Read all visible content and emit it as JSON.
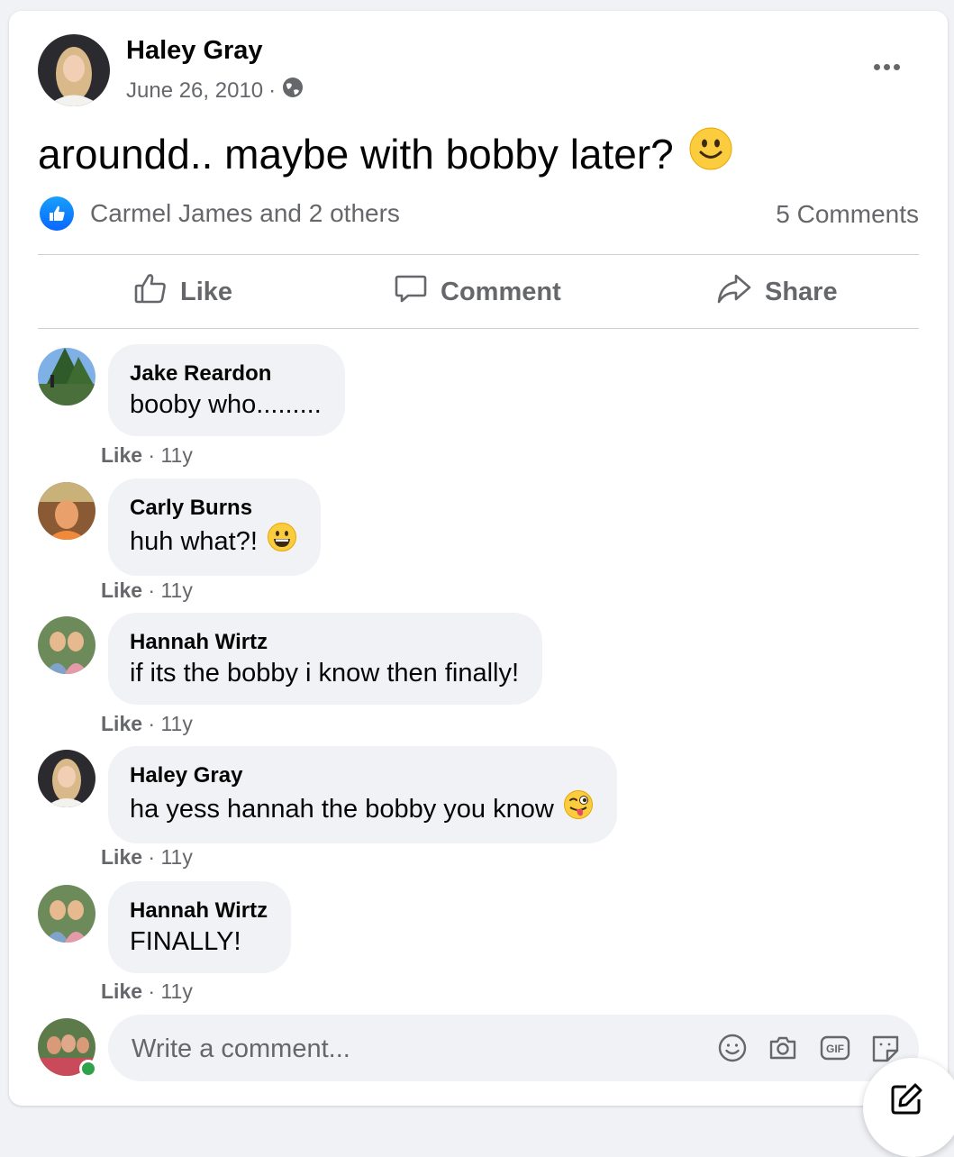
{
  "post": {
    "author": "Haley Gray",
    "date": "June 26, 2010",
    "separator": "·",
    "text": "aroundd.. maybe with bobby later?",
    "reactions_text": "Carmel James and 2 others",
    "comments_count": "5 Comments"
  },
  "actions": {
    "like": "Like",
    "comment": "Comment",
    "share": "Share"
  },
  "comments": [
    {
      "author": "Jake Reardon",
      "text": "booby who.........",
      "like": "Like",
      "time": "· 11y"
    },
    {
      "author": "Carly Burns",
      "text": "huh what?!",
      "like": "Like",
      "time": "· 11y"
    },
    {
      "author": "Hannah Wirtz",
      "text": "if its the bobby i know then finally!",
      "like": "Like",
      "time": "· 11y"
    },
    {
      "author": "Haley Gray",
      "text": "ha yess hannah the bobby you know",
      "like": "Like",
      "time": "· 11y"
    },
    {
      "author": "Hannah Wirtz",
      "text": "FINALLY!",
      "like": "Like",
      "time": "· 11y"
    }
  ],
  "composer": {
    "placeholder": "Write a comment..."
  },
  "colors": {
    "accent": "#0866ff",
    "text_secondary": "#65676b",
    "bubble": "#f0f2f5",
    "online": "#31a24c"
  },
  "icons": [
    "more-icon",
    "globe-icon",
    "smile-emoji-icon",
    "like-badge-icon",
    "thumbs-up-icon",
    "comment-icon",
    "share-icon",
    "grin-emoji-icon",
    "wink-tongue-emoji-icon",
    "emoji-picker-icon",
    "camera-icon",
    "gif-icon",
    "sticker-icon",
    "compose-icon"
  ]
}
